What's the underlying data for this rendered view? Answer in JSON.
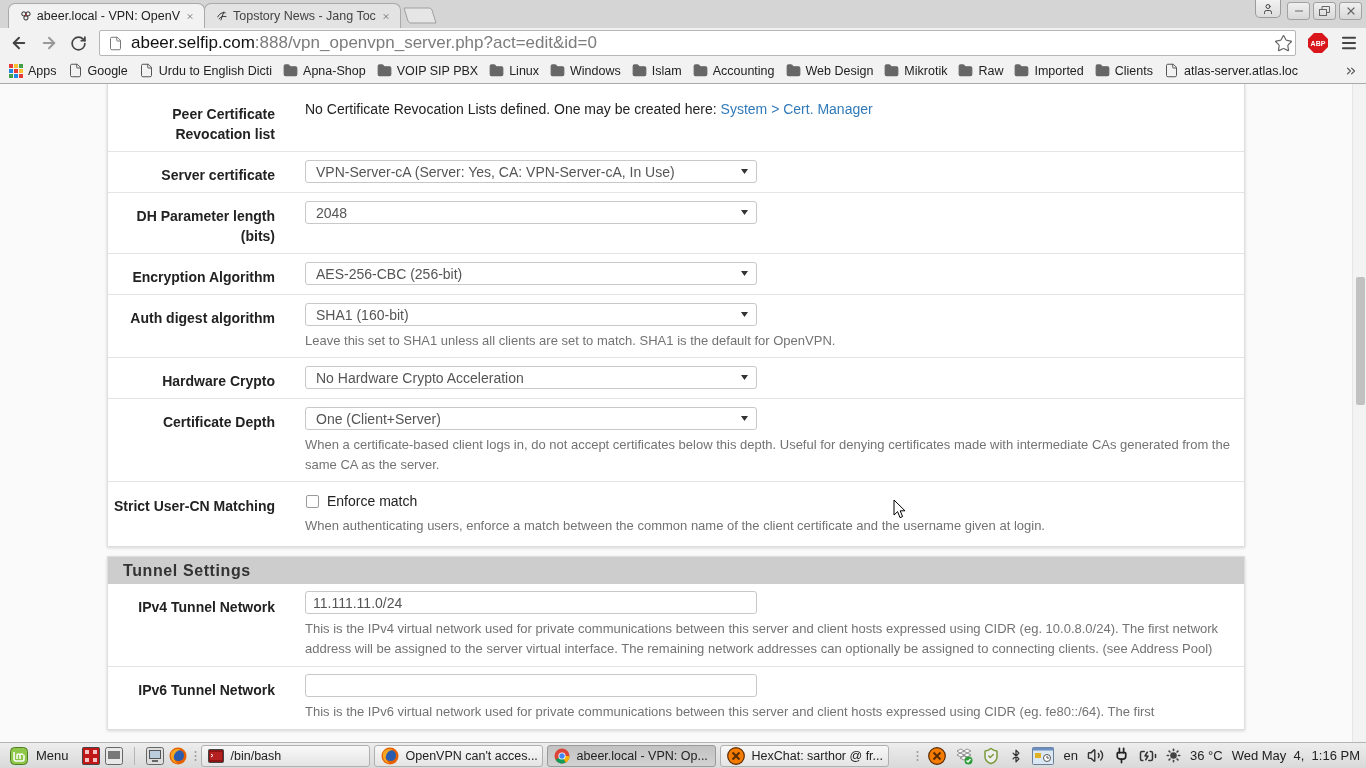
{
  "browser": {
    "tabs": [
      {
        "title": "abeer.local - VPN: OpenV",
        "selected": true,
        "kind": "rings"
      },
      {
        "title": "Topstory News - Jang Toc",
        "selected": false,
        "kind": "script"
      }
    ],
    "address": {
      "host": "abeer.selfip.com",
      "path": ":888/vpn_openvpn_server.php?act=edit&id=0"
    },
    "extension_badge": "ABP",
    "bookmarks": [
      {
        "label": "Apps",
        "kind": "apps"
      },
      {
        "label": "Google",
        "kind": "page"
      },
      {
        "label": "Urdu to English Dicti",
        "kind": "page"
      },
      {
        "label": "Apna-Shop",
        "kind": "folder"
      },
      {
        "label": "VOIP SIP PBX",
        "kind": "folder"
      },
      {
        "label": "Linux",
        "kind": "folder"
      },
      {
        "label": "Windows",
        "kind": "folder"
      },
      {
        "label": "Islam",
        "kind": "folder"
      },
      {
        "label": "Accounting",
        "kind": "folder"
      },
      {
        "label": "Web Design",
        "kind": "folder"
      },
      {
        "label": "Mikrotik",
        "kind": "folder"
      },
      {
        "label": "Raw",
        "kind": "folder"
      },
      {
        "label": "Imported",
        "kind": "folder"
      },
      {
        "label": "Clients",
        "kind": "folder"
      },
      {
        "label": "atlas-server.atlas.loc",
        "kind": "page"
      }
    ]
  },
  "sections": [
    {
      "rows": [
        {
          "label": "Peer Certificate Revocation list",
          "kind": "note",
          "text": "No Certificate Revocation Lists defined. One may be created here:",
          "link": "System > Cert. Manager"
        },
        {
          "label": "Server certificate",
          "kind": "select",
          "value": "VPN-Server-cA (Server: Yes, CA: VPN-Server-cA, In Use)"
        },
        {
          "label": "DH Parameter length (bits)",
          "kind": "select",
          "value": "2048"
        },
        {
          "label": "Encryption Algorithm",
          "kind": "select",
          "value": "AES-256-CBC (256-bit)"
        },
        {
          "label": "Auth digest algorithm",
          "kind": "select",
          "value": "SHA1 (160-bit)",
          "help": "Leave this set to SHA1 unless all clients are set to match. SHA1 is the default for OpenVPN."
        },
        {
          "label": "Hardware Crypto",
          "kind": "select",
          "value": "No Hardware Crypto Acceleration"
        },
        {
          "label": "Certificate Depth",
          "kind": "select",
          "value": "One (Client+Server)",
          "help": "When a certificate-based client logs in, do not accept certificates below this depth. Useful for denying certificates made with intermediate CAs generated from the same CA as the server."
        },
        {
          "label": "Strict User-CN Matching",
          "kind": "checkbox",
          "option": "Enforce match",
          "checked": false,
          "help": "When authenticating users, enforce a match between the common name of the client certificate and the username given at login."
        }
      ]
    },
    {
      "title": "Tunnel Settings",
      "rows": [
        {
          "label": "IPv4 Tunnel Network",
          "kind": "input",
          "value": "11.111.11.0/24",
          "help": "This is the IPv4 virtual network used for private communications between this server and client hosts expressed using CIDR (eg. 10.0.8.0/24). The first network address will be assigned to the server virtual interface. The remaining network addresses can optionally be assigned to connecting clients. (see Address Pool)"
        },
        {
          "label": "IPv6 Tunnel Network",
          "kind": "input",
          "help": "This is the IPv6 virtual network used for private communications between this server and client hosts expressed using CIDR (eg. fe80::/64). The first"
        }
      ]
    }
  ],
  "taskbar": {
    "menu": "Menu",
    "windows": [
      {
        "title": "/bin/bash",
        "kind": "terminal",
        "selected": false
      },
      {
        "title": "OpenVPN can't acces...",
        "kind": "firefox",
        "selected": false
      },
      {
        "title": "abeer.local - VPN: Op...",
        "kind": "chrome",
        "selected": true
      },
      {
        "title": "HexChat: sarthor @ fr...",
        "kind": "hexchat",
        "selected": false
      }
    ],
    "keyboard_layout": "en",
    "temperature": "36 °C",
    "clock": "Wed May  4,  1:16 PM"
  }
}
